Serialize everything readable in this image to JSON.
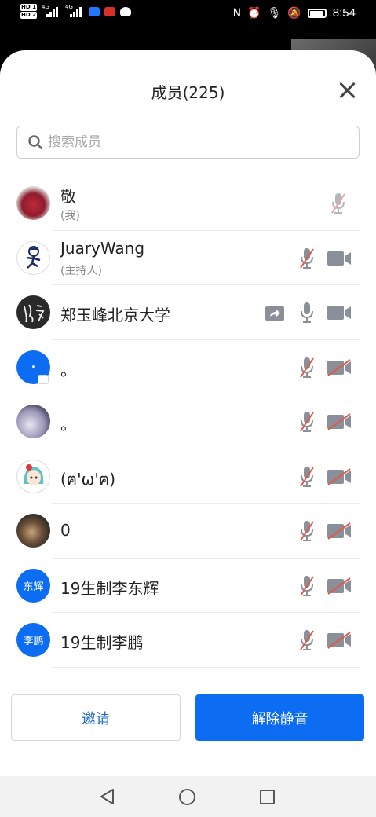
{
  "status_bar": {
    "time": "8:54",
    "sim1": "HD 1",
    "sim2": "HD 2",
    "network": "4G"
  },
  "sheet": {
    "title": "成员(225)",
    "search_placeholder": "搜索成员"
  },
  "members": [
    {
      "name": "敬",
      "role": "(我)",
      "avatar": "photo-flowers",
      "mic": "muted",
      "cam": "none",
      "share": false
    },
    {
      "name": "JuaryWang",
      "role": "(主持人)",
      "avatar": "cartoon-runner",
      "mic": "muted",
      "cam": "on",
      "share": false
    },
    {
      "name": "郑玉峰北京大学",
      "role": "",
      "avatar": "calligraphy",
      "mic": "on",
      "cam": "on",
      "share": true
    },
    {
      "name": "。",
      "role": "",
      "avatar": "blue-dot",
      "mic": "muted",
      "cam": "off",
      "share": false
    },
    {
      "name": "。",
      "role": "",
      "avatar": "photo-person",
      "mic": "muted",
      "cam": "off",
      "share": false
    },
    {
      "name": "(ฅ'ω'ฅ)",
      "role": "",
      "avatar": "anime-girl",
      "mic": "muted",
      "cam": "off",
      "share": false
    },
    {
      "name": "0",
      "role": "",
      "avatar": "photo-food",
      "mic": "muted",
      "cam": "off",
      "share": false
    },
    {
      "name": "19生制李东辉",
      "role": "",
      "avatar_text": "东辉",
      "avatar": "initials",
      "mic": "muted",
      "cam": "off",
      "share": false
    },
    {
      "name": "19生制李鹏",
      "role": "",
      "avatar_text": "李鹏",
      "avatar": "initials",
      "mic": "muted",
      "cam": "off",
      "share": false
    }
  ],
  "buttons": {
    "invite": "邀请",
    "unmute": "解除静音"
  },
  "colors": {
    "accent": "#0c6cf2",
    "invite_text": "#1a67d0",
    "muted_slash": "#e05a4a",
    "icon_gray": "#8a8f99"
  }
}
